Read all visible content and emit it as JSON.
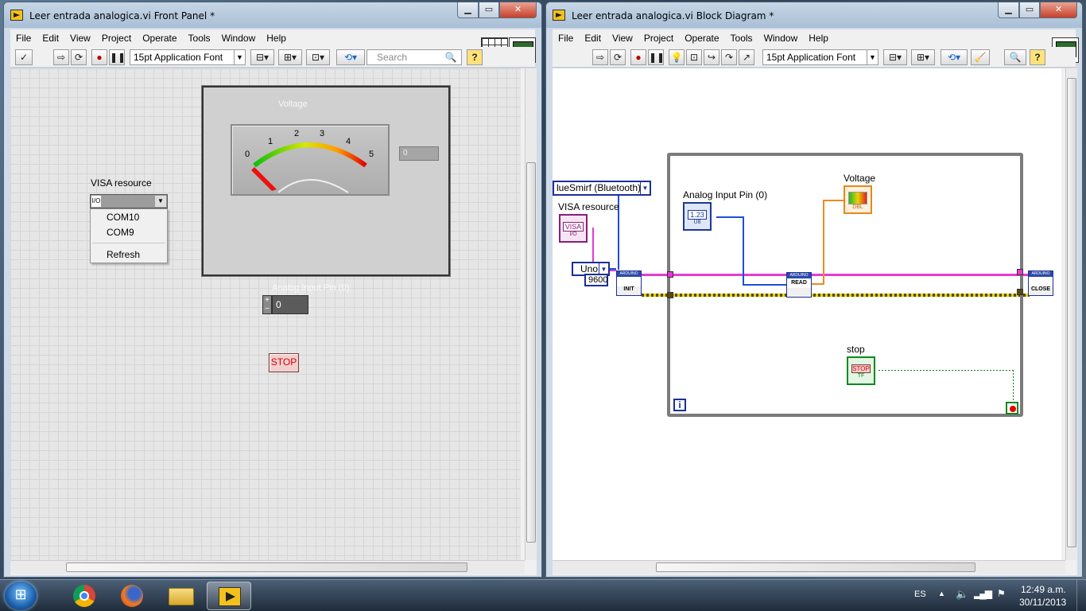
{
  "front_panel": {
    "title": "Leer entrada analogica.vi Front Panel *",
    "menu": [
      "File",
      "Edit",
      "View",
      "Project",
      "Operate",
      "Tools",
      "Window",
      "Help"
    ],
    "font_label": "15pt Application Font",
    "search_placeholder": "Search",
    "gauge": {
      "label": "Voltage",
      "scale": [
        "0",
        "1",
        "2",
        "3",
        "4",
        "5"
      ],
      "digital_value": "0"
    },
    "visa": {
      "label": "VISA resource",
      "prefix": "I/O",
      "options": [
        "COM10",
        "COM9"
      ],
      "refresh": "Refresh"
    },
    "analog_pin": {
      "label": "Analog Input Pin (0)",
      "value": "0"
    },
    "stop_label": "STOP"
  },
  "block_diagram": {
    "title": "Leer entrada analogica.vi Block Diagram *",
    "menu": [
      "File",
      "Edit",
      "View",
      "Project",
      "Operate",
      "Tools",
      "Window",
      "Help"
    ],
    "font_label": "15pt Application Font",
    "bluesmirf": "lueSmirf (Bluetooth)",
    "visa_label": "VISA resource",
    "visa_term": "VISA",
    "visa_io": "I/O",
    "board": "Uno",
    "baud": "9600",
    "analog_label": "Analog Input Pin (0)",
    "analog_term": "1.23",
    "analog_type": "U8",
    "voltage_label": "Voltage",
    "voltage_type": "DBL",
    "stop_label": "stop",
    "stop_term": "STOP",
    "stop_type": "TF",
    "init": "INIT",
    "read": "READ",
    "close": "CLOSE",
    "arduino": "ARDUINO",
    "iter": "i"
  },
  "taskbar": {
    "lang": "ES",
    "time": "12:49 a.m.",
    "date": "30/11/2013"
  },
  "colors": {
    "wire_visa": "#e43bd1",
    "wire_numeric": "#1c4fd6",
    "wire_dbl": "#ee8a23",
    "wire_bool": "#0e7a1a"
  }
}
